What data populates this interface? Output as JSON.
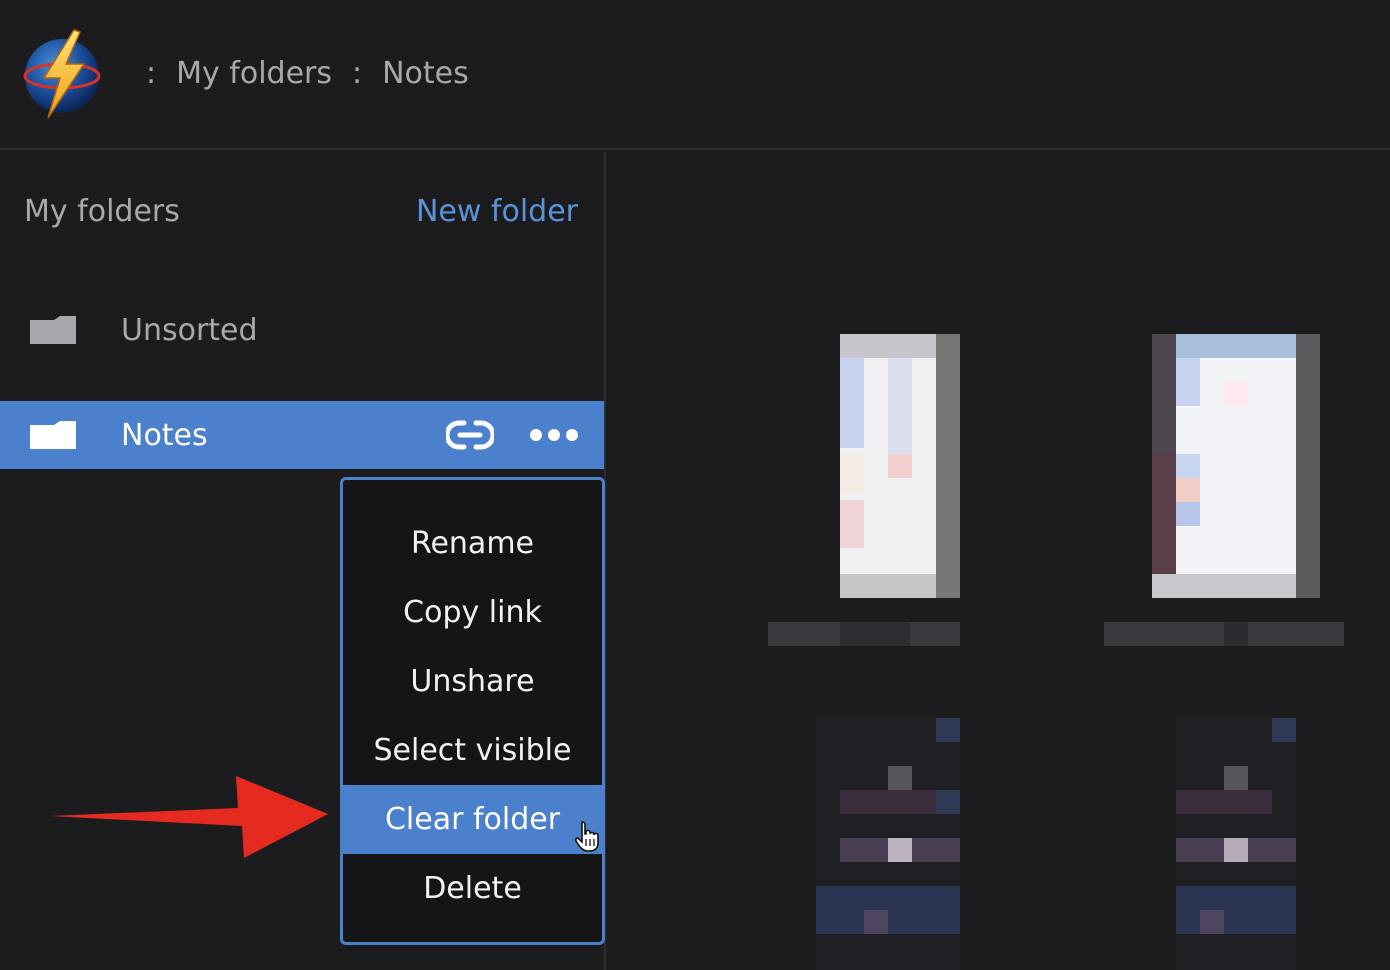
{
  "breadcrumb": {
    "separator": ":",
    "items": [
      "My folders",
      "Notes"
    ]
  },
  "sidebar": {
    "title": "My folders",
    "new_folder_label": "New folder",
    "folders": [
      {
        "label": "Unsorted",
        "selected": false
      },
      {
        "label": "Notes",
        "selected": true
      }
    ]
  },
  "context_menu": {
    "items": [
      {
        "label": "Rename"
      },
      {
        "label": "Copy link"
      },
      {
        "label": "Unshare"
      },
      {
        "label": "Select visible"
      },
      {
        "label": "Clear folder",
        "highlighted": true
      },
      {
        "label": "Delete"
      }
    ]
  },
  "icons": {
    "logo": "lightning-globe-logo",
    "folder": "folder-icon",
    "link": "link-icon",
    "more": "more-dots-icon",
    "pointer": "hand-pointer-icon",
    "annotation": "red-arrow-annotation"
  },
  "colors": {
    "accent": "#4b80cc",
    "link_text": "#5b93d8",
    "background": "#1c1c1e",
    "annotation_arrow": "#e52b1f"
  }
}
